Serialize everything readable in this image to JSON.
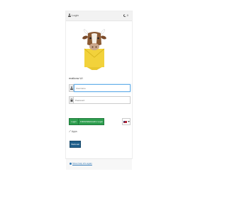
{
  "topbar": {
    "login_label": "Login",
    "theme_badge": "0"
  },
  "logo": {
    "icon": "cow-mascot-logo"
  },
  "login_form": {
    "welcome_text": "mailcow UI",
    "username_placeholder": "Username",
    "password_placeholder": "Password",
    "login_button": "Login",
    "webauthn_button": "FIDO2/WebAuthn Login",
    "language": "en"
  },
  "apps": {
    "label": "Apps",
    "webmail_button": "Webmail"
  },
  "footer": {
    "link_text": "Show help info again"
  },
  "colors": {
    "success": "#2e9e4f",
    "primary": "#1f5f8b",
    "link": "#337ab7"
  }
}
